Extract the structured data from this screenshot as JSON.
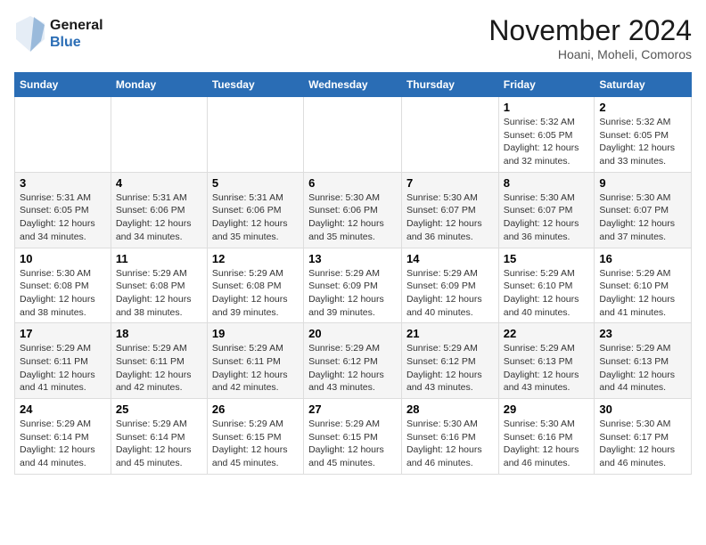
{
  "header": {
    "logo_line1": "General",
    "logo_line2": "Blue",
    "month": "November 2024",
    "location": "Hoani, Moheli, Comoros"
  },
  "weekdays": [
    "Sunday",
    "Monday",
    "Tuesday",
    "Wednesday",
    "Thursday",
    "Friday",
    "Saturday"
  ],
  "weeks": [
    [
      {
        "day": "",
        "info": ""
      },
      {
        "day": "",
        "info": ""
      },
      {
        "day": "",
        "info": ""
      },
      {
        "day": "",
        "info": ""
      },
      {
        "day": "",
        "info": ""
      },
      {
        "day": "1",
        "info": "Sunrise: 5:32 AM\nSunset: 6:05 PM\nDaylight: 12 hours and 32 minutes."
      },
      {
        "day": "2",
        "info": "Sunrise: 5:32 AM\nSunset: 6:05 PM\nDaylight: 12 hours and 33 minutes."
      }
    ],
    [
      {
        "day": "3",
        "info": "Sunrise: 5:31 AM\nSunset: 6:05 PM\nDaylight: 12 hours and 34 minutes."
      },
      {
        "day": "4",
        "info": "Sunrise: 5:31 AM\nSunset: 6:06 PM\nDaylight: 12 hours and 34 minutes."
      },
      {
        "day": "5",
        "info": "Sunrise: 5:31 AM\nSunset: 6:06 PM\nDaylight: 12 hours and 35 minutes."
      },
      {
        "day": "6",
        "info": "Sunrise: 5:30 AM\nSunset: 6:06 PM\nDaylight: 12 hours and 35 minutes."
      },
      {
        "day": "7",
        "info": "Sunrise: 5:30 AM\nSunset: 6:07 PM\nDaylight: 12 hours and 36 minutes."
      },
      {
        "day": "8",
        "info": "Sunrise: 5:30 AM\nSunset: 6:07 PM\nDaylight: 12 hours and 36 minutes."
      },
      {
        "day": "9",
        "info": "Sunrise: 5:30 AM\nSunset: 6:07 PM\nDaylight: 12 hours and 37 minutes."
      }
    ],
    [
      {
        "day": "10",
        "info": "Sunrise: 5:30 AM\nSunset: 6:08 PM\nDaylight: 12 hours and 38 minutes."
      },
      {
        "day": "11",
        "info": "Sunrise: 5:29 AM\nSunset: 6:08 PM\nDaylight: 12 hours and 38 minutes."
      },
      {
        "day": "12",
        "info": "Sunrise: 5:29 AM\nSunset: 6:08 PM\nDaylight: 12 hours and 39 minutes."
      },
      {
        "day": "13",
        "info": "Sunrise: 5:29 AM\nSunset: 6:09 PM\nDaylight: 12 hours and 39 minutes."
      },
      {
        "day": "14",
        "info": "Sunrise: 5:29 AM\nSunset: 6:09 PM\nDaylight: 12 hours and 40 minutes."
      },
      {
        "day": "15",
        "info": "Sunrise: 5:29 AM\nSunset: 6:10 PM\nDaylight: 12 hours and 40 minutes."
      },
      {
        "day": "16",
        "info": "Sunrise: 5:29 AM\nSunset: 6:10 PM\nDaylight: 12 hours and 41 minutes."
      }
    ],
    [
      {
        "day": "17",
        "info": "Sunrise: 5:29 AM\nSunset: 6:11 PM\nDaylight: 12 hours and 41 minutes."
      },
      {
        "day": "18",
        "info": "Sunrise: 5:29 AM\nSunset: 6:11 PM\nDaylight: 12 hours and 42 minutes."
      },
      {
        "day": "19",
        "info": "Sunrise: 5:29 AM\nSunset: 6:11 PM\nDaylight: 12 hours and 42 minutes."
      },
      {
        "day": "20",
        "info": "Sunrise: 5:29 AM\nSunset: 6:12 PM\nDaylight: 12 hours and 43 minutes."
      },
      {
        "day": "21",
        "info": "Sunrise: 5:29 AM\nSunset: 6:12 PM\nDaylight: 12 hours and 43 minutes."
      },
      {
        "day": "22",
        "info": "Sunrise: 5:29 AM\nSunset: 6:13 PM\nDaylight: 12 hours and 43 minutes."
      },
      {
        "day": "23",
        "info": "Sunrise: 5:29 AM\nSunset: 6:13 PM\nDaylight: 12 hours and 44 minutes."
      }
    ],
    [
      {
        "day": "24",
        "info": "Sunrise: 5:29 AM\nSunset: 6:14 PM\nDaylight: 12 hours and 44 minutes."
      },
      {
        "day": "25",
        "info": "Sunrise: 5:29 AM\nSunset: 6:14 PM\nDaylight: 12 hours and 45 minutes."
      },
      {
        "day": "26",
        "info": "Sunrise: 5:29 AM\nSunset: 6:15 PM\nDaylight: 12 hours and 45 minutes."
      },
      {
        "day": "27",
        "info": "Sunrise: 5:29 AM\nSunset: 6:15 PM\nDaylight: 12 hours and 45 minutes."
      },
      {
        "day": "28",
        "info": "Sunrise: 5:30 AM\nSunset: 6:16 PM\nDaylight: 12 hours and 46 minutes."
      },
      {
        "day": "29",
        "info": "Sunrise: 5:30 AM\nSunset: 6:16 PM\nDaylight: 12 hours and 46 minutes."
      },
      {
        "day": "30",
        "info": "Sunrise: 5:30 AM\nSunset: 6:17 PM\nDaylight: 12 hours and 46 minutes."
      }
    ]
  ]
}
